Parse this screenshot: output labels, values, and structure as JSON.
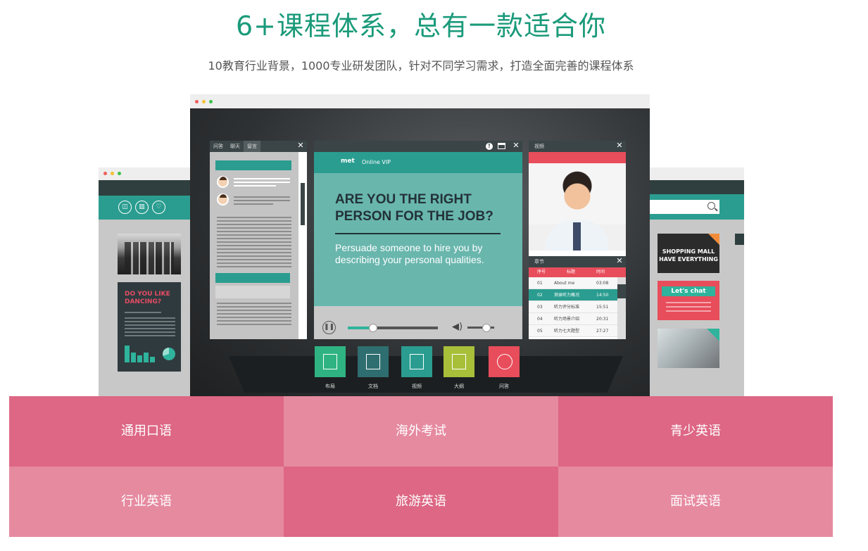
{
  "header": {
    "title": "6+课程体系，总有一款适合你",
    "subtitle": "10教育行业背景，1000专业研发团队，针对不同学习需求，打造全面完善的课程体系"
  },
  "mockup": {
    "left_window": {
      "poster_title": "DO YOU LIKE DANCING?"
    },
    "right_window": {
      "ad1_line1": "SHOPPING MALL",
      "ad1_line2": "HAVE EVERYTHING",
      "ad2_text": "Let's chat"
    },
    "chat_panel": {
      "tabs": [
        "问答",
        "聊天",
        "留言"
      ]
    },
    "slide_panel": {
      "logo": "met",
      "logo_tag": "Online VIP",
      "slide_title": "ARE YOU THE RIGHT PERSON FOR THE JOB?",
      "slide_desc": "Persuade someone to hire you by describing your personal qualities.",
      "progress": 0.28,
      "volume": 0.7
    },
    "video_panel": {
      "title": "视频"
    },
    "chapter_panel": {
      "title": "章节",
      "columns": [
        "序号",
        "标题",
        "时间"
      ],
      "rows": [
        {
          "no": "01",
          "title": "About me",
          "time": "03:08",
          "active": false
        },
        {
          "no": "02",
          "title": "测录听力概况",
          "time": "14:50",
          "active": true
        },
        {
          "no": "03",
          "title": "听力评分标准",
          "time": "15:51",
          "active": false
        },
        {
          "no": "04",
          "title": "听力场景介绍",
          "time": "20:31",
          "active": false
        },
        {
          "no": "05",
          "title": "听力七大题型",
          "time": "27:27",
          "active": false
        }
      ]
    },
    "dock": [
      {
        "label": "布局",
        "color": "#2fb383"
      },
      {
        "label": "文档",
        "color": "#2f6e70"
      },
      {
        "label": "视频",
        "color": "#2a9d90"
      },
      {
        "label": "大纲",
        "color": "#a8bf3a"
      },
      {
        "label": "问答",
        "color": "#e84d5b"
      }
    ]
  },
  "categories": [
    {
      "label": "通用口语"
    },
    {
      "label": "海外考试"
    },
    {
      "label": "青少英语"
    },
    {
      "label": "行业英语"
    },
    {
      "label": "旅游英语"
    },
    {
      "label": "面试英语"
    }
  ]
}
